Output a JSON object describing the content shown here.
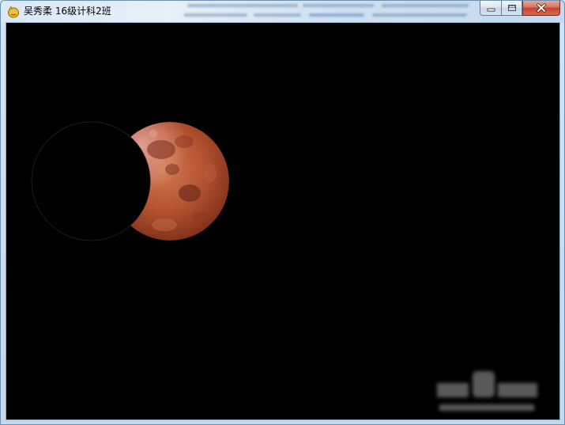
{
  "window": {
    "title": "吴秀柔 16级计科2班",
    "app_icon": "pygame-snake-icon"
  },
  "caption_buttons": {
    "minimize_icon": "minimize-icon",
    "maximize_icon": "maximize-icon",
    "close_icon": "close-icon"
  },
  "scene": {
    "background_color": "#000000",
    "moon_colors": [
      "#c86a45",
      "#a84a2e",
      "#6e2a1c"
    ],
    "shadow_color": "#000000",
    "watermark_icon": "watermark-logo-icon"
  }
}
